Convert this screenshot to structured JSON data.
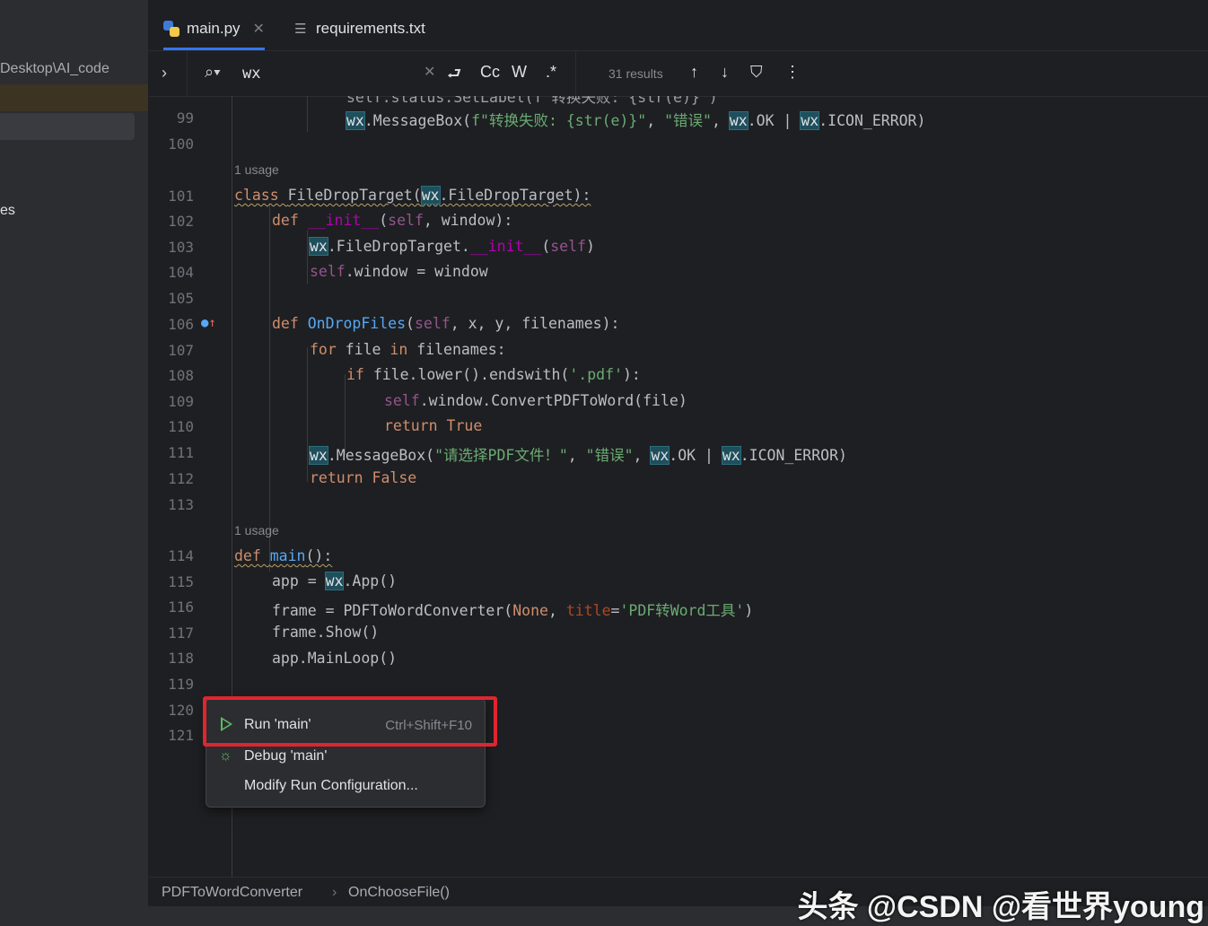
{
  "sidebar": {
    "path_fragment": "Desktop\\AI_code",
    "item_fragment": "es"
  },
  "tabs": [
    {
      "label": "main.py",
      "active": true
    },
    {
      "label": "requirements.txt",
      "active": false
    }
  ],
  "find": {
    "query": "wx",
    "case_label": "Cc",
    "word_label": "W",
    "regex_label": ".*",
    "results": "31 results"
  },
  "code": {
    "usage_label": "1 usage",
    "line_numbers": [
      "99",
      "100",
      "101",
      "102",
      "103",
      "104",
      "105",
      "106",
      "107",
      "108",
      "109",
      "110",
      "111",
      "112",
      "113",
      "114",
      "115",
      "116",
      "117",
      "118",
      "119",
      "120",
      "121"
    ],
    "partial_line": "self.status.SetLabel(f\"转换失败: {str(e)}\")",
    "lines": {
      "l99": {
        "pre": "f\"转换失败: {str(e)}\"",
        "sep": ", ",
        "err": "\"错误\"",
        "mb": ".MessageBox(",
        "ok": ".OK | ",
        "icon": ".ICON_ERROR)"
      },
      "l101": {
        "a": "class ",
        "b": "FileDropTarget(",
        "c": ".FileDropTarget):"
      },
      "l102": {
        "a": "def ",
        "b": "__init__",
        "c": "(",
        "d": "self",
        "e": ", window):"
      },
      "l103": {
        "b": ".FileDropTarget.",
        "c": "__init__",
        "d": "(",
        "e": "self",
        "f": ")"
      },
      "l104": {
        "a": "self",
        "b": ".window = window"
      },
      "l106": {
        "a": "def ",
        "b": "OnDropFiles",
        "c": "(",
        "d": "self",
        "e": ", x, y, filenames):"
      },
      "l107": {
        "a": "for ",
        "b": "file ",
        "c": "in ",
        "d": "filenames:"
      },
      "l108": {
        "a": "if ",
        "b": "file.lower().endswith(",
        "c": "'.pdf'",
        "d": "):"
      },
      "l109": {
        "a": "self",
        "b": ".window.ConvertPDFToWord(file)"
      },
      "l110": {
        "a": "return ",
        "b": "True"
      },
      "l111": {
        "b": ".MessageBox(",
        "c": "\"请选择PDF文件！\"",
        "d": ", ",
        "e": "\"错误\"",
        "f": ", ",
        "g": ".OK | ",
        "h": ".ICON_ERROR)"
      },
      "l112": {
        "a": "return ",
        "b": "False"
      },
      "l114": {
        "a": "def ",
        "b": "main",
        "c": "():"
      },
      "l115": {
        "a": "app = ",
        "c": ".App()"
      },
      "l116": {
        "a": "frame = PDFToWordConverter(",
        "b": "None",
        "c": ", ",
        "d": "title",
        "e": "=",
        "f": "'PDF转Word工具'",
        "g": ")"
      },
      "l117": {
        "a": "frame.Show()"
      },
      "l118": {
        "a": "app.MainLoop()"
      },
      "wx": "wx"
    }
  },
  "menu": {
    "run_label": "Run 'main'",
    "run_shortcut": "Ctrl+Shift+F10",
    "debug_label": "Debug 'main'",
    "modify_label": "Modify Run Configuration..."
  },
  "breadcrumbs": [
    "PDFToWordConverter",
    "OnChooseFile()"
  ],
  "watermark": "头条 @CSDN @看世界young",
  "colors": {
    "accent": "#3574f0",
    "highlight_box": "#e0252f",
    "run_green": "#5fb865"
  }
}
